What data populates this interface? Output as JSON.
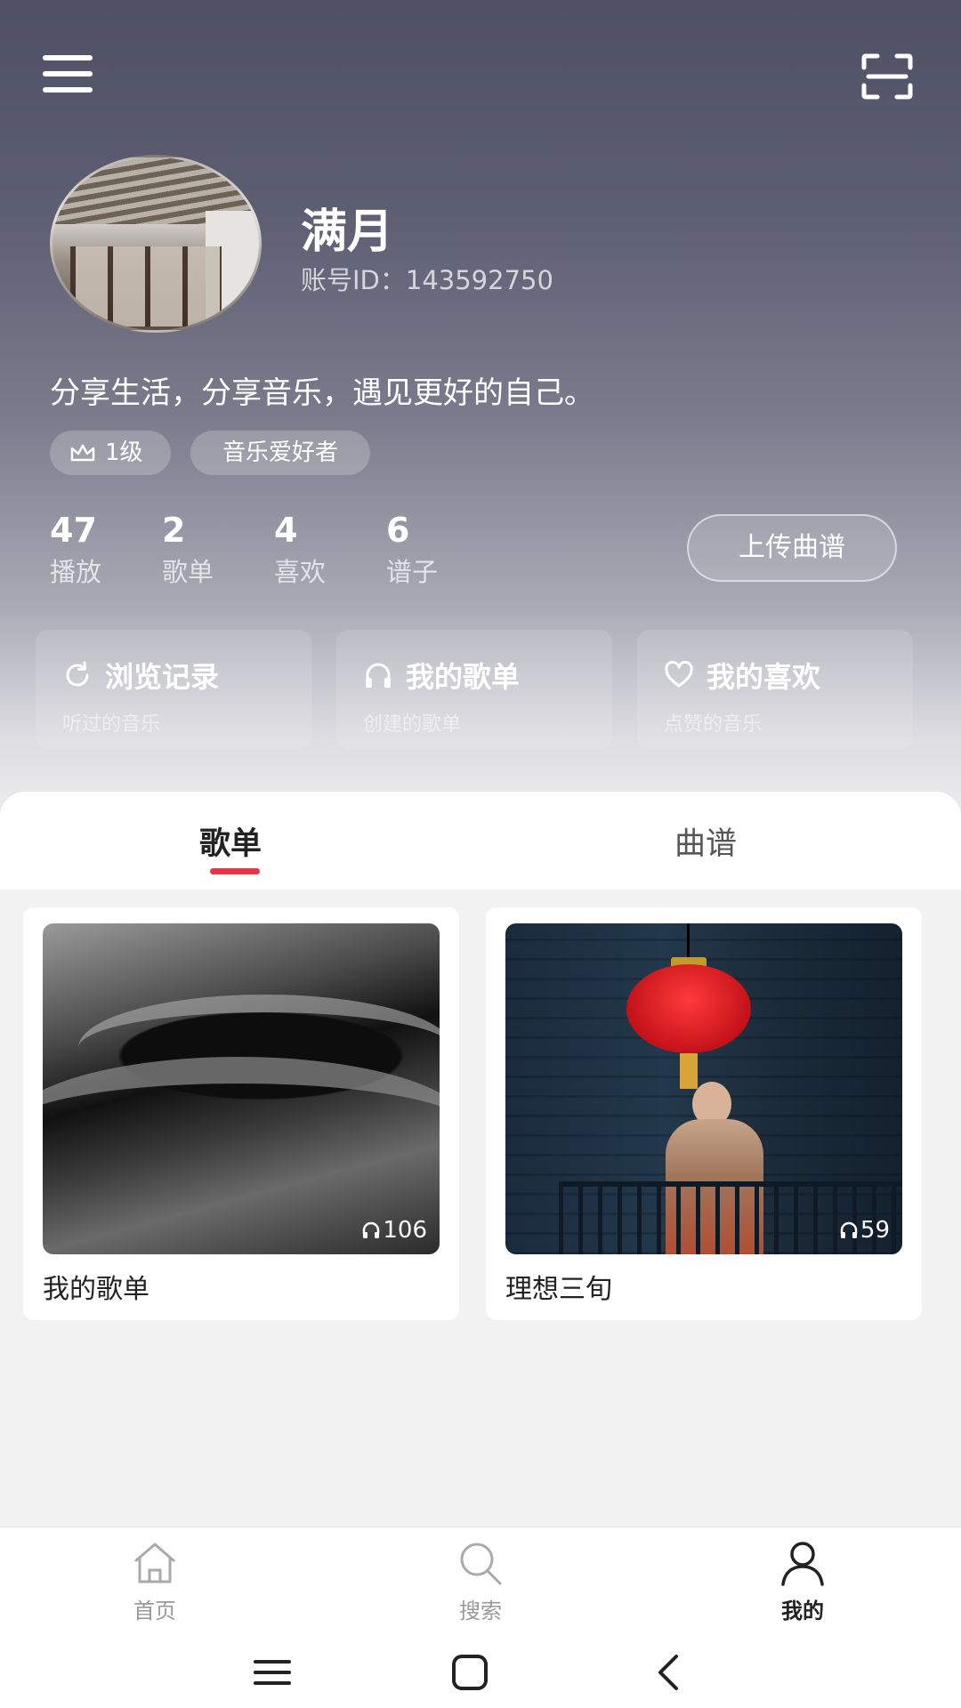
{
  "profile": {
    "name": "满月",
    "account_id": "账号ID：143592750",
    "bio": "分享生活，分享音乐，遇见更好的自己。",
    "level": "1级",
    "title_tag": "音乐爱好者"
  },
  "stats": [
    {
      "value": "47",
      "label": "播放"
    },
    {
      "value": "2",
      "label": "歌单"
    },
    {
      "value": "4",
      "label": "喜欢"
    },
    {
      "value": "6",
      "label": "谱子"
    }
  ],
  "upload_button": "上传曲谱",
  "quick_links": [
    {
      "title": "浏览记录",
      "subtitle": "听过的音乐",
      "icon": "refresh-icon"
    },
    {
      "title": "我的歌单",
      "subtitle": "创建的歌单",
      "icon": "headphones-icon"
    },
    {
      "title": "我的喜欢",
      "subtitle": "点赞的音乐",
      "icon": "heart-icon"
    }
  ],
  "tabs": [
    "歌单",
    "曲谱"
  ],
  "active_tab": 0,
  "playlists": [
    {
      "name": "我的歌单",
      "plays": "106"
    },
    {
      "name": "理想三旬",
      "plays": "59"
    }
  ],
  "bottom_nav": [
    {
      "label": "首页",
      "icon": "home-icon"
    },
    {
      "label": "搜索",
      "icon": "search-icon"
    },
    {
      "label": "我的",
      "icon": "user-icon"
    }
  ],
  "active_nav": 2,
  "colors": {
    "accent": "#e8344b",
    "header_top": "#4f5064"
  }
}
